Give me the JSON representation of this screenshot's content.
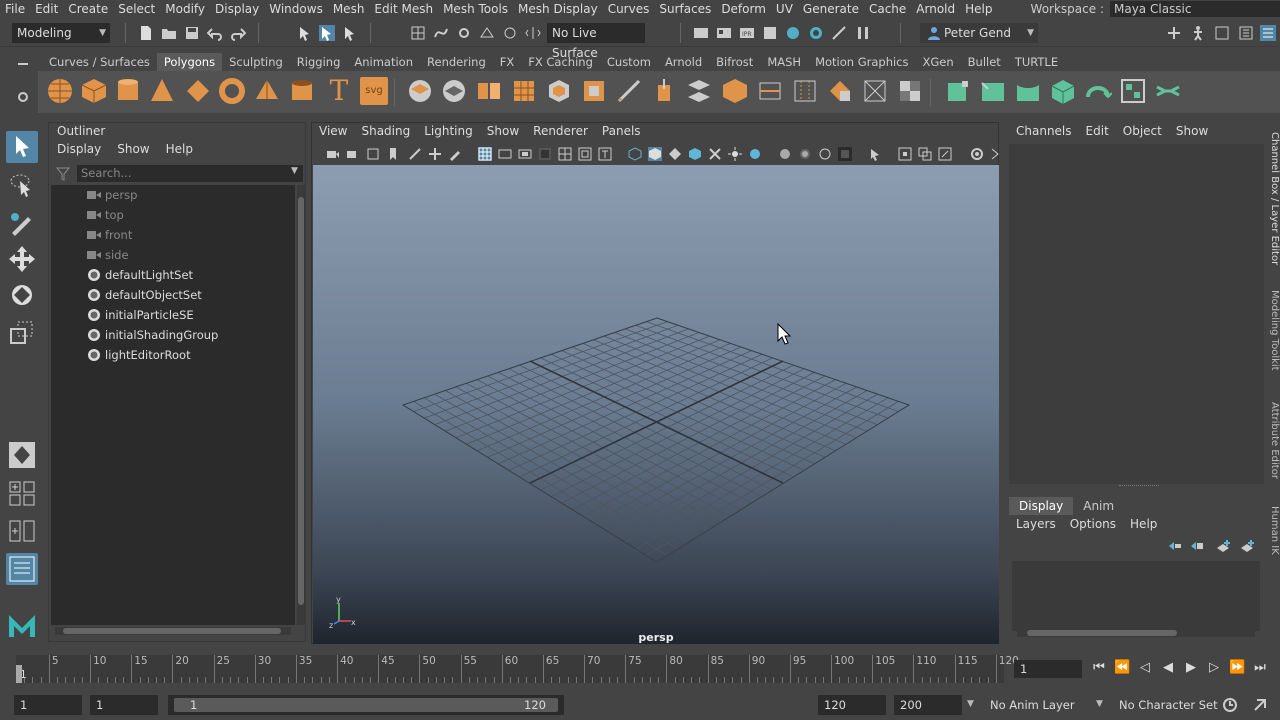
{
  "menubar": {
    "items": [
      "File",
      "Edit",
      "Create",
      "Select",
      "Modify",
      "Display",
      "Windows",
      "Mesh",
      "Edit Mesh",
      "Mesh Tools",
      "Mesh Display",
      "Curves",
      "Surfaces",
      "Deform",
      "UV",
      "Generate",
      "Cache",
      "Arnold",
      "Help"
    ],
    "workspace_label": "Workspace :",
    "workspace_value": "Maya Classic"
  },
  "statusline": {
    "mode": "Modeling",
    "live_surface": "No Live Surface",
    "user": "Peter Gend"
  },
  "shelf": {
    "tabs": [
      "Curves / Surfaces",
      "Polygons",
      "Sculpting",
      "Rigging",
      "Animation",
      "Rendering",
      "FX",
      "FX Caching",
      "Custom",
      "Arnold",
      "Bifrost",
      "MASH",
      "Motion Graphics",
      "XGen",
      "Bullet",
      "TURTLE"
    ],
    "active_tab": "Polygons",
    "text_icon": "T",
    "svg_icon": "svg"
  },
  "outliner": {
    "title": "Outliner",
    "menus": [
      "Display",
      "Show",
      "Help"
    ],
    "search_placeholder": "Search...",
    "items": [
      {
        "label": "persp",
        "type": "camera"
      },
      {
        "label": "top",
        "type": "camera"
      },
      {
        "label": "front",
        "type": "camera"
      },
      {
        "label": "side",
        "type": "camera"
      },
      {
        "label": "defaultLightSet",
        "type": "set"
      },
      {
        "label": "defaultObjectSet",
        "type": "set"
      },
      {
        "label": "initialParticleSE",
        "type": "set"
      },
      {
        "label": "initialShadingGroup",
        "type": "set"
      },
      {
        "label": "lightEditorRoot",
        "type": "set"
      }
    ]
  },
  "viewport": {
    "menus": [
      "View",
      "Shading",
      "Lighting",
      "Show",
      "Renderer",
      "Panels"
    ],
    "camera_label": "persp",
    "axis_x": "x",
    "axis_y": "y",
    "axis_z": "z"
  },
  "channelbox": {
    "menus": [
      "Channels",
      "Edit",
      "Object",
      "Show"
    ]
  },
  "layereditor": {
    "tabs": [
      "Display",
      "Anim"
    ],
    "active_tab": "Display",
    "menus": [
      "Layers",
      "Options",
      "Help"
    ]
  },
  "sidetabs": [
    "Channel Box / Layer Editor",
    "Modeling Toolkit",
    "Attribute Editor",
    "Human IK"
  ],
  "timeslider": {
    "ticks": [
      "5",
      "10",
      "15",
      "20",
      "25",
      "30",
      "35",
      "40",
      "45",
      "50",
      "55",
      "60",
      "65",
      "70",
      "75",
      "80",
      "85",
      "90",
      "95",
      "100",
      "105",
      "110",
      "115",
      "120"
    ],
    "start_marker": "1",
    "current_frame": "1"
  },
  "rangeslider": {
    "start_frame": "1",
    "playback_start": "1",
    "slider_start": "1",
    "slider_end": "120",
    "playback_end": "120",
    "end_frame": "200",
    "anim_layer": "No Anim Layer",
    "character_set": "No Character Set"
  }
}
